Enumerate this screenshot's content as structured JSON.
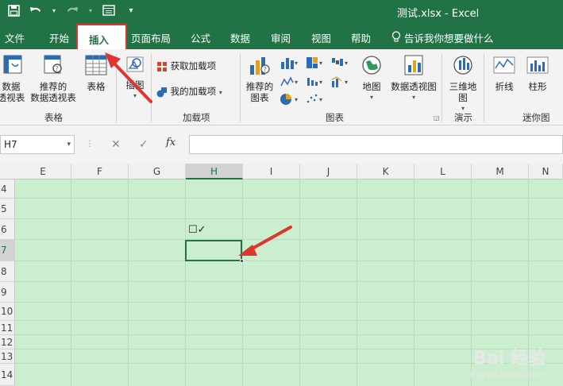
{
  "title_bar": {
    "file_title": "测试.xlsx  -  Excel",
    "qat_icons": [
      "save-icon",
      "undo-icon",
      "redo-icon",
      "print-preview-icon",
      "customize-qat-icon"
    ]
  },
  "menu_tabs": [
    "文件",
    "开始",
    "插入",
    "页面布局",
    "公式",
    "数据",
    "审阅",
    "视图",
    "帮助"
  ],
  "active_tab": "插入",
  "tell_me": "告诉我你想要做什么",
  "ribbon": {
    "tables": {
      "pivot_table": [
        "数据",
        "透视表"
      ],
      "recommended_pivot": [
        "推荐的",
        "数据透视表"
      ],
      "table": "表格",
      "group": "表格"
    },
    "illustrations": {
      "label": "插图"
    },
    "addins": {
      "get_addins": "获取加载项",
      "my_addins": "我的加载项",
      "group": "加载项"
    },
    "charts": {
      "recommended": [
        "推荐的",
        "图表"
      ],
      "map": "地图",
      "pivot_chart": "数据透视图",
      "group": "图表"
    },
    "tours": {
      "map3d": [
        "三维地",
        "图"
      ],
      "group": "演示"
    },
    "sparklines": {
      "line": "折线",
      "column": "柱形",
      "group": "迷你图"
    }
  },
  "formula_bar": {
    "name_box": "H7",
    "cancel": "✕",
    "enter": "✓",
    "fx": "fx",
    "content": ""
  },
  "grid": {
    "columns": [
      "E",
      "F",
      "G",
      "H",
      "I",
      "J",
      "K",
      "L",
      "M",
      "N"
    ],
    "selected_column": "H",
    "rows": [
      "4",
      "5",
      "6",
      "7",
      "8",
      "9",
      "10",
      "11",
      "12",
      "13",
      "14"
    ],
    "selected_row": "7",
    "cell_h6": "☐✓"
  },
  "watermark": {
    "brand": "Bai 经验",
    "url": "jingyan.baidu.com"
  },
  "colors": {
    "excel_green": "#217346",
    "sheet_fill": "#cbeecf",
    "highlight_red": "#e0342f"
  }
}
